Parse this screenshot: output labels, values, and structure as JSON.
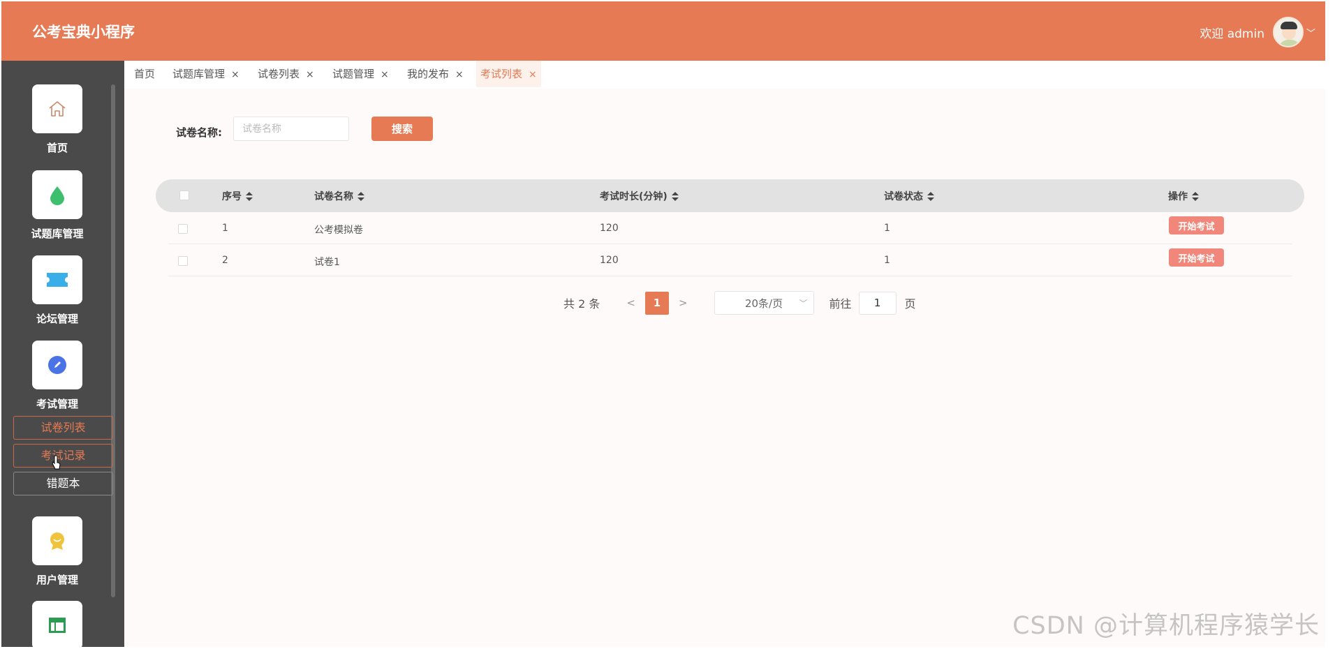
{
  "header": {
    "app_title": "公考宝典小程序",
    "welcome": "欢迎 admin",
    "accent_color": "#e67a54"
  },
  "sidebar": {
    "items": [
      {
        "label": "首页",
        "icon": "home-icon"
      },
      {
        "label": "试题库管理",
        "icon": "drop-icon"
      },
      {
        "label": "论坛管理",
        "icon": "ticket-icon"
      },
      {
        "label": "考试管理",
        "icon": "pencil-icon"
      },
      {
        "label": "用户管理",
        "icon": "award-icon"
      },
      {
        "label": "",
        "icon": "layout-icon"
      }
    ],
    "sub_items": [
      {
        "label": "试卷列表"
      },
      {
        "label": "考试记录"
      },
      {
        "label": "错题本"
      }
    ]
  },
  "tabs": [
    {
      "label": "首页"
    },
    {
      "label": "试题库管理",
      "close": "×"
    },
    {
      "label": "试卷列表",
      "close": "×"
    },
    {
      "label": "试题管理",
      "close": "×"
    },
    {
      "label": "我的发布",
      "close": "×"
    },
    {
      "label": "考试列表",
      "close": "×"
    }
  ],
  "search": {
    "label": "试卷名称:",
    "placeholder": "试卷名称",
    "button": "搜索"
  },
  "table": {
    "columns": [
      "序号",
      "试卷名称",
      "考试时长(分钟)",
      "试卷状态",
      "操作"
    ],
    "rows": [
      {
        "index": "1",
        "name": "公考模拟卷",
        "duration": "120",
        "status": "1",
        "action": "开始考试"
      },
      {
        "index": "2",
        "name": "试卷1",
        "duration": "120",
        "status": "1",
        "action": "开始考试"
      }
    ]
  },
  "pagination": {
    "total": "共 2 条",
    "prev": "<",
    "current": "1",
    "next": ">",
    "page_size": "20条/页",
    "goto_label": "前往",
    "goto_value": "1",
    "goto_unit": "页"
  },
  "watermark": "CSDN @计算机程序猿学长"
}
